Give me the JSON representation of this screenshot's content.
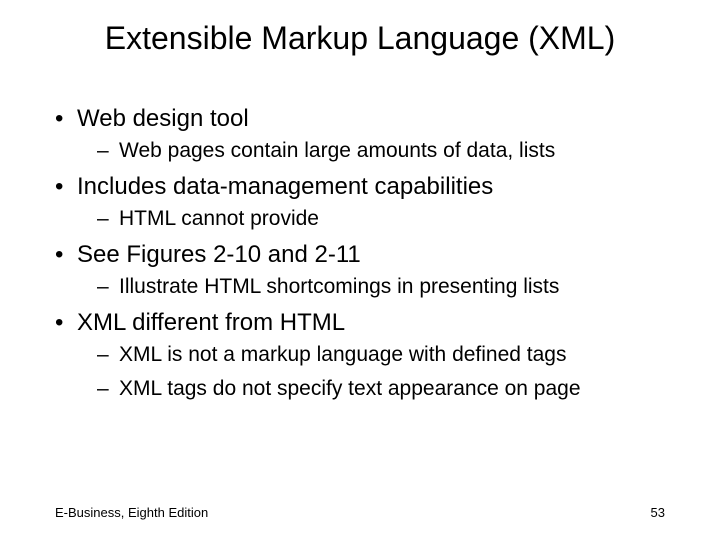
{
  "title": "Extensible Markup Language (XML)",
  "bullets": [
    {
      "level": 1,
      "text": "Web design tool"
    },
    {
      "level": 2,
      "text": "Web pages contain large amounts of data, lists"
    },
    {
      "level": 1,
      "text": "Includes data-management capabilities"
    },
    {
      "level": 2,
      "text": "HTML cannot provide"
    },
    {
      "level": 1,
      "text": "See Figures 2-10 and 2-11"
    },
    {
      "level": 2,
      "text": "Illustrate HTML shortcomings in presenting lists"
    },
    {
      "level": 1,
      "text": "XML different from HTML"
    },
    {
      "level": 2,
      "text": "XML is not a markup language with defined tags"
    },
    {
      "level": 2,
      "text": "XML tags do not specify text appearance on page"
    }
  ],
  "footer_left": "E-Business, Eighth Edition",
  "footer_right": "53"
}
